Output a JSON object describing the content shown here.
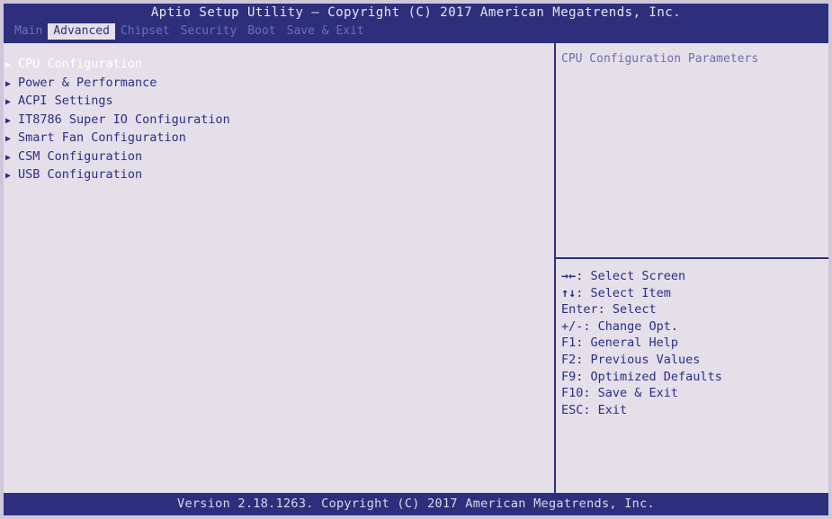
{
  "header": {
    "title": "Aptio Setup Utility – Copyright (C) 2017 American Megatrends, Inc.",
    "tabs": [
      {
        "label": "Main"
      },
      {
        "label": "Advanced"
      },
      {
        "label": "Chipset"
      },
      {
        "label": "Security"
      },
      {
        "label": "Boot"
      },
      {
        "label": "Save & Exit"
      }
    ],
    "active_tab": "Advanced"
  },
  "menu": {
    "items": [
      {
        "label": "CPU Configuration"
      },
      {
        "label": "Power & Performance"
      },
      {
        "label": "ACPI Settings"
      },
      {
        "label": "IT8786 Super IO Configuration"
      },
      {
        "label": "Smart Fan Configuration"
      },
      {
        "label": "CSM Configuration"
      },
      {
        "label": "USB Configuration"
      }
    ],
    "selected": "CPU Configuration"
  },
  "help": {
    "description": "CPU Configuration Parameters",
    "keys": [
      {
        "key": "→←",
        "text": ": Select Screen"
      },
      {
        "key": "↑↓",
        "text": ": Select Item"
      },
      {
        "key": "Enter",
        "text": ": Select"
      },
      {
        "key": "+/-",
        "text": ": Change Opt."
      },
      {
        "key": "F1",
        "text": ": General Help"
      },
      {
        "key": "F2",
        "text": ": Previous Values"
      },
      {
        "key": "F9",
        "text": ": Optimized Defaults"
      },
      {
        "key": "F10",
        "text": ": Save & Exit"
      },
      {
        "key": "ESC",
        "text": ": Exit"
      }
    ]
  },
  "footer": {
    "version": "Version 2.18.1263. Copyright (C) 2017 American Megatrends, Inc."
  },
  "colors": {
    "bar": "#2d2f7c",
    "background": "#e4dfe9",
    "text": "#2a2e88",
    "selected_text": "#ffffff"
  }
}
